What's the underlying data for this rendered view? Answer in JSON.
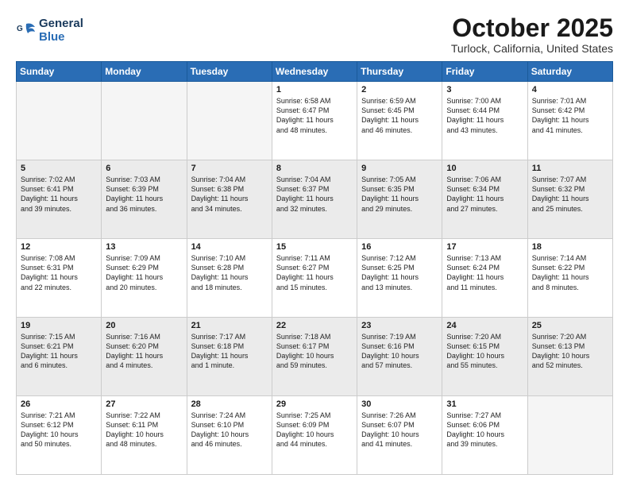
{
  "logo": {
    "line1": "General",
    "line2": "Blue"
  },
  "title": "October 2025",
  "location": "Turlock, California, United States",
  "weekdays": [
    "Sunday",
    "Monday",
    "Tuesday",
    "Wednesday",
    "Thursday",
    "Friday",
    "Saturday"
  ],
  "weeks": [
    [
      {
        "day": "",
        "info": ""
      },
      {
        "day": "",
        "info": ""
      },
      {
        "day": "",
        "info": ""
      },
      {
        "day": "1",
        "info": "Sunrise: 6:58 AM\nSunset: 6:47 PM\nDaylight: 11 hours\nand 48 minutes."
      },
      {
        "day": "2",
        "info": "Sunrise: 6:59 AM\nSunset: 6:45 PM\nDaylight: 11 hours\nand 46 minutes."
      },
      {
        "day": "3",
        "info": "Sunrise: 7:00 AM\nSunset: 6:44 PM\nDaylight: 11 hours\nand 43 minutes."
      },
      {
        "day": "4",
        "info": "Sunrise: 7:01 AM\nSunset: 6:42 PM\nDaylight: 11 hours\nand 41 minutes."
      }
    ],
    [
      {
        "day": "5",
        "info": "Sunrise: 7:02 AM\nSunset: 6:41 PM\nDaylight: 11 hours\nand 39 minutes."
      },
      {
        "day": "6",
        "info": "Sunrise: 7:03 AM\nSunset: 6:39 PM\nDaylight: 11 hours\nand 36 minutes."
      },
      {
        "day": "7",
        "info": "Sunrise: 7:04 AM\nSunset: 6:38 PM\nDaylight: 11 hours\nand 34 minutes."
      },
      {
        "day": "8",
        "info": "Sunrise: 7:04 AM\nSunset: 6:37 PM\nDaylight: 11 hours\nand 32 minutes."
      },
      {
        "day": "9",
        "info": "Sunrise: 7:05 AM\nSunset: 6:35 PM\nDaylight: 11 hours\nand 29 minutes."
      },
      {
        "day": "10",
        "info": "Sunrise: 7:06 AM\nSunset: 6:34 PM\nDaylight: 11 hours\nand 27 minutes."
      },
      {
        "day": "11",
        "info": "Sunrise: 7:07 AM\nSunset: 6:32 PM\nDaylight: 11 hours\nand 25 minutes."
      }
    ],
    [
      {
        "day": "12",
        "info": "Sunrise: 7:08 AM\nSunset: 6:31 PM\nDaylight: 11 hours\nand 22 minutes."
      },
      {
        "day": "13",
        "info": "Sunrise: 7:09 AM\nSunset: 6:29 PM\nDaylight: 11 hours\nand 20 minutes."
      },
      {
        "day": "14",
        "info": "Sunrise: 7:10 AM\nSunset: 6:28 PM\nDaylight: 11 hours\nand 18 minutes."
      },
      {
        "day": "15",
        "info": "Sunrise: 7:11 AM\nSunset: 6:27 PM\nDaylight: 11 hours\nand 15 minutes."
      },
      {
        "day": "16",
        "info": "Sunrise: 7:12 AM\nSunset: 6:25 PM\nDaylight: 11 hours\nand 13 minutes."
      },
      {
        "day": "17",
        "info": "Sunrise: 7:13 AM\nSunset: 6:24 PM\nDaylight: 11 hours\nand 11 minutes."
      },
      {
        "day": "18",
        "info": "Sunrise: 7:14 AM\nSunset: 6:22 PM\nDaylight: 11 hours\nand 8 minutes."
      }
    ],
    [
      {
        "day": "19",
        "info": "Sunrise: 7:15 AM\nSunset: 6:21 PM\nDaylight: 11 hours\nand 6 minutes."
      },
      {
        "day": "20",
        "info": "Sunrise: 7:16 AM\nSunset: 6:20 PM\nDaylight: 11 hours\nand 4 minutes."
      },
      {
        "day": "21",
        "info": "Sunrise: 7:17 AM\nSunset: 6:18 PM\nDaylight: 11 hours\nand 1 minute."
      },
      {
        "day": "22",
        "info": "Sunrise: 7:18 AM\nSunset: 6:17 PM\nDaylight: 10 hours\nand 59 minutes."
      },
      {
        "day": "23",
        "info": "Sunrise: 7:19 AM\nSunset: 6:16 PM\nDaylight: 10 hours\nand 57 minutes."
      },
      {
        "day": "24",
        "info": "Sunrise: 7:20 AM\nSunset: 6:15 PM\nDaylight: 10 hours\nand 55 minutes."
      },
      {
        "day": "25",
        "info": "Sunrise: 7:20 AM\nSunset: 6:13 PM\nDaylight: 10 hours\nand 52 minutes."
      }
    ],
    [
      {
        "day": "26",
        "info": "Sunrise: 7:21 AM\nSunset: 6:12 PM\nDaylight: 10 hours\nand 50 minutes."
      },
      {
        "day": "27",
        "info": "Sunrise: 7:22 AM\nSunset: 6:11 PM\nDaylight: 10 hours\nand 48 minutes."
      },
      {
        "day": "28",
        "info": "Sunrise: 7:24 AM\nSunset: 6:10 PM\nDaylight: 10 hours\nand 46 minutes."
      },
      {
        "day": "29",
        "info": "Sunrise: 7:25 AM\nSunset: 6:09 PM\nDaylight: 10 hours\nand 44 minutes."
      },
      {
        "day": "30",
        "info": "Sunrise: 7:26 AM\nSunset: 6:07 PM\nDaylight: 10 hours\nand 41 minutes."
      },
      {
        "day": "31",
        "info": "Sunrise: 7:27 AM\nSunset: 6:06 PM\nDaylight: 10 hours\nand 39 minutes."
      },
      {
        "day": "",
        "info": ""
      }
    ]
  ]
}
